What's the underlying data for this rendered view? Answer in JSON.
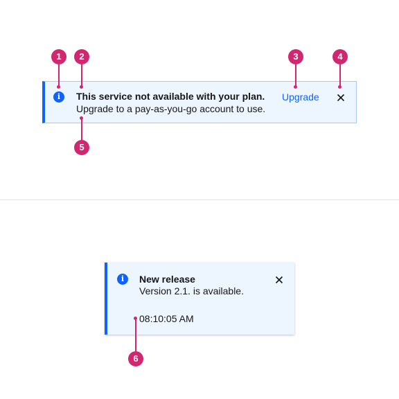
{
  "inline_notification": {
    "icon": "info-icon",
    "title": "This service not available with your plan.",
    "subtitle": "Upgrade to a pay-as-you-go account to use.",
    "action_label": "Upgrade",
    "close_icon": "close-icon"
  },
  "toast_notification": {
    "icon": "info-icon",
    "title": "New release",
    "subtitle": "Version 2.1. is available.",
    "caption": "08:10:05 AM",
    "close_icon": "close-icon"
  },
  "callouts": [
    "1",
    "2",
    "3",
    "4",
    "5",
    "6"
  ],
  "colors": {
    "accent": "#0f62fe",
    "notification_bg": "#edf5ff",
    "notification_border": "#a6c8ff",
    "callout": "#d12771",
    "divider": "#e0e0e0"
  }
}
